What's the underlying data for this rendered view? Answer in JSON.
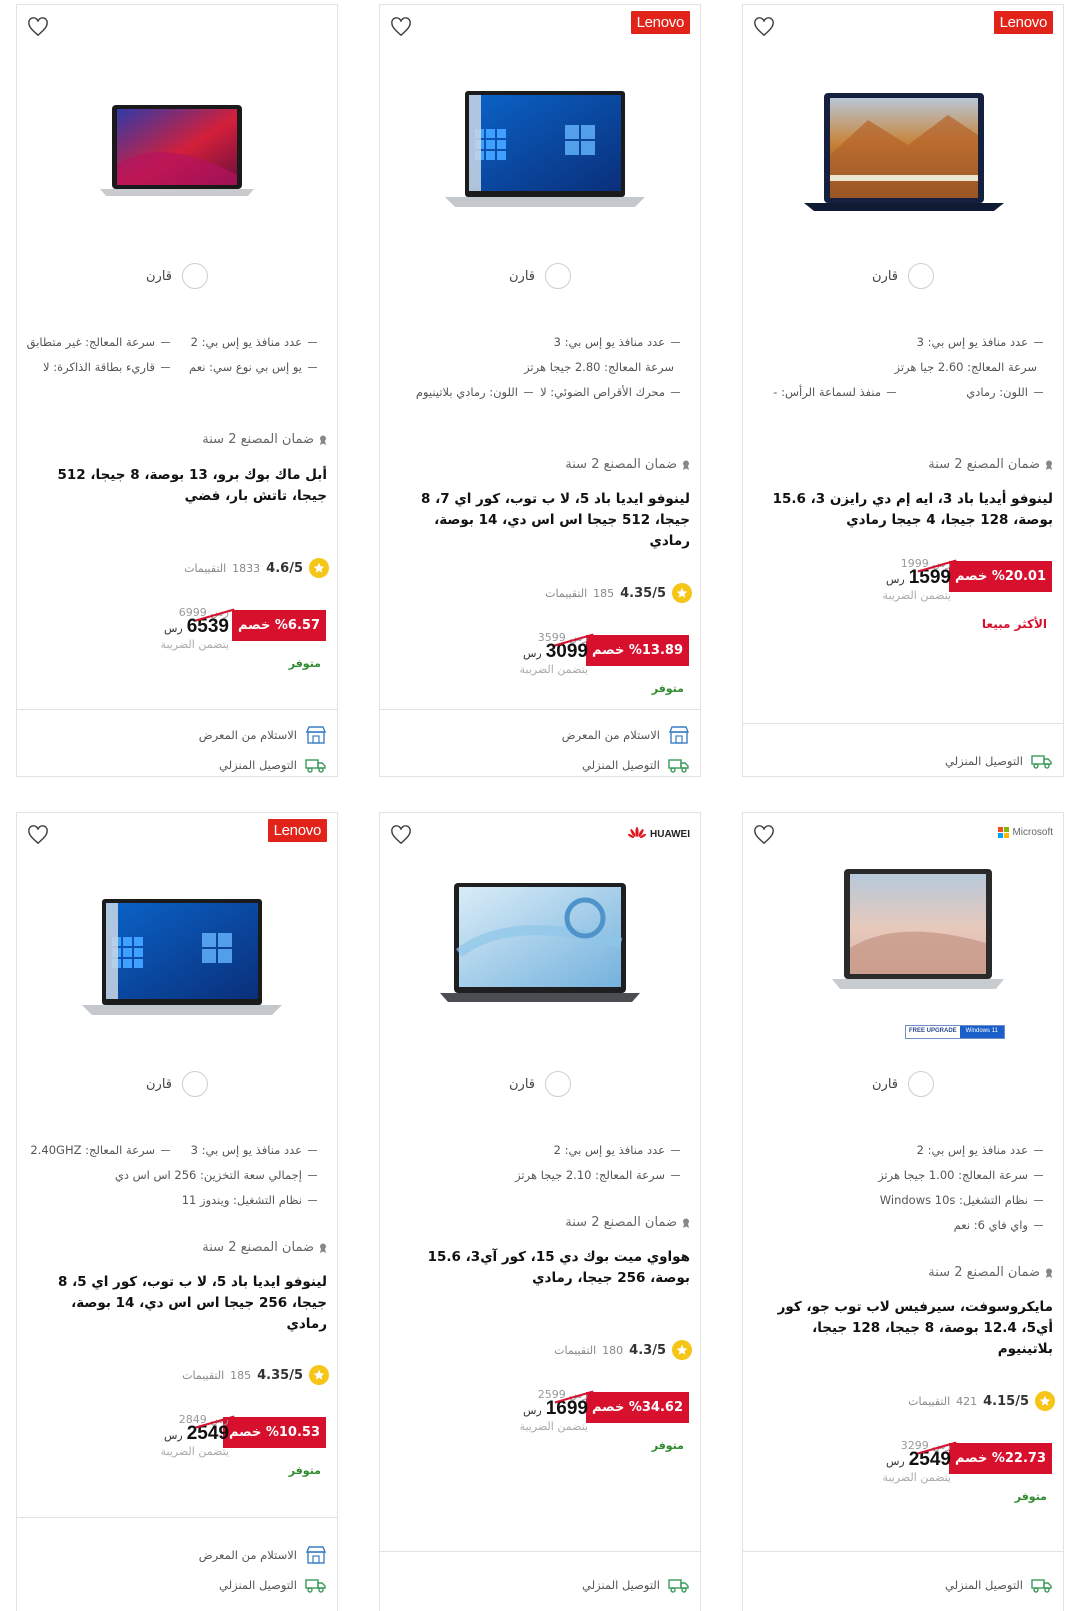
{
  "common": {
    "compare_label": "قارن",
    "warranty": "ضمان المصنع 2 سنة",
    "ratings_label": "التقييمات",
    "currency": "رس",
    "tax_note": "يتضمن الضريبة",
    "available": "متوفر",
    "best_seller": "الأكثر مبيعا",
    "pickup": "الاستلام من المعرض",
    "home_delivery": "التوصيل المنزلي"
  },
  "colors": {
    "accent": "#d7102e",
    "available": "#2e8b2e",
    "star": "#f5c518",
    "delivery_icon": "#3a9a5a",
    "store_icon": "#3a7fc4"
  },
  "products": [
    {
      "brand": "Lenovo",
      "specs": [
        "عدد منافذ يو إس بي: 3",
        "سرعة المعالج: 2.60 جيا هرتز",
        "اللون: رمادي",
        "منفذ لسماعة الرأس: -"
      ],
      "name": "لينوفو أيديا باد 3، ايه إم دي رايزن 3، 15.6 بوصة، 128 جيجا، 4 جيجا رمادي",
      "discount": "%20.01 خصم",
      "old_price": "1999",
      "price": "1599",
      "best_seller": true
    },
    {
      "brand": "Lenovo",
      "specs": [
        "عدد منافذ يو إس بي: 3",
        "سرعة المعالج: 2.80 جيجا هرتز",
        "محرك الأقراص الضوئي: لا",
        "اللون: رمادي بلاتينيوم"
      ],
      "name": "لينوفو ايديا باد 5، لا ب توب، كور اي 7، 8 جيجا، 512 جيجا اس اس دي، 14 بوصة، رمادي",
      "rating": "4.35/5",
      "rating_count": "185",
      "discount": "%13.89 خصم",
      "old_price": "3599",
      "price": "3099"
    },
    {
      "brand": "",
      "specs": [
        "عدد منافذ يو إس بي: 2",
        "سرعة المعالج: غير متطابق",
        "يو إس بي نوع سي: نعم",
        "قاريء بطاقة الذاكرة: لا"
      ],
      "name": "أبل ماك بوك برو، 13 بوصة، 8 جيجا، 512 جيجا، تاتش بار، فضي",
      "rating": "4.6/5",
      "rating_count": "1833",
      "discount": "%6.57 خصم",
      "old_price": "6999",
      "price": "6539"
    },
    {
      "brand": "Microsoft",
      "badge_a": "FREE UPGRADE",
      "badge_b": "Windows 11",
      "specs": [
        "عدد منافذ يو إس بي: 2",
        "سرعة المعالج: 1.00 جيجا هرتز",
        "نظام التشغيل: Windows 10s",
        "واي فاي 6: نعم"
      ],
      "name": "مايكروسوفت، سيرفيس لاب توب جو، كور أي5، 12.4 بوصة، 8 جيجا، 128 جيجا، بلاتينيوم",
      "rating": "4.15/5",
      "rating_count": "421",
      "discount": "%22.73 خصم",
      "old_price": "3299",
      "price": "2549"
    },
    {
      "brand": "HUAWEI",
      "specs": [
        "عدد منافذ يو إس بي: 2",
        "سرعة المعالج: 2.10 جيجا هرتز"
      ],
      "name": "هواوي ميت بوك دي 15، كور آي3، 15.6 بوصة، 256 جيجا، رمادي",
      "rating": "4.3/5",
      "rating_count": "180",
      "discount": "%34.62 خصم",
      "old_price": "2599",
      "price": "1699"
    },
    {
      "brand": "Lenovo",
      "specs": [
        "عدد منافذ يو إس بي: 3",
        "سرعة المعالج: 2.40GHZ",
        "إجمالي سعة التخزين: 256 اس اس دي",
        "نظام التشغيل: ويندوز 11"
      ],
      "name": "لينوفو ايديا باد 5، لا ب توب، كور اي 5، 8 جيجا، 256 جيجا اس اس دي، 14 بوصة، رمادي",
      "rating": "4.35/5",
      "rating_count": "185",
      "discount": "%10.53 خصم",
      "old_price": "2849",
      "price": "2549"
    }
  ]
}
